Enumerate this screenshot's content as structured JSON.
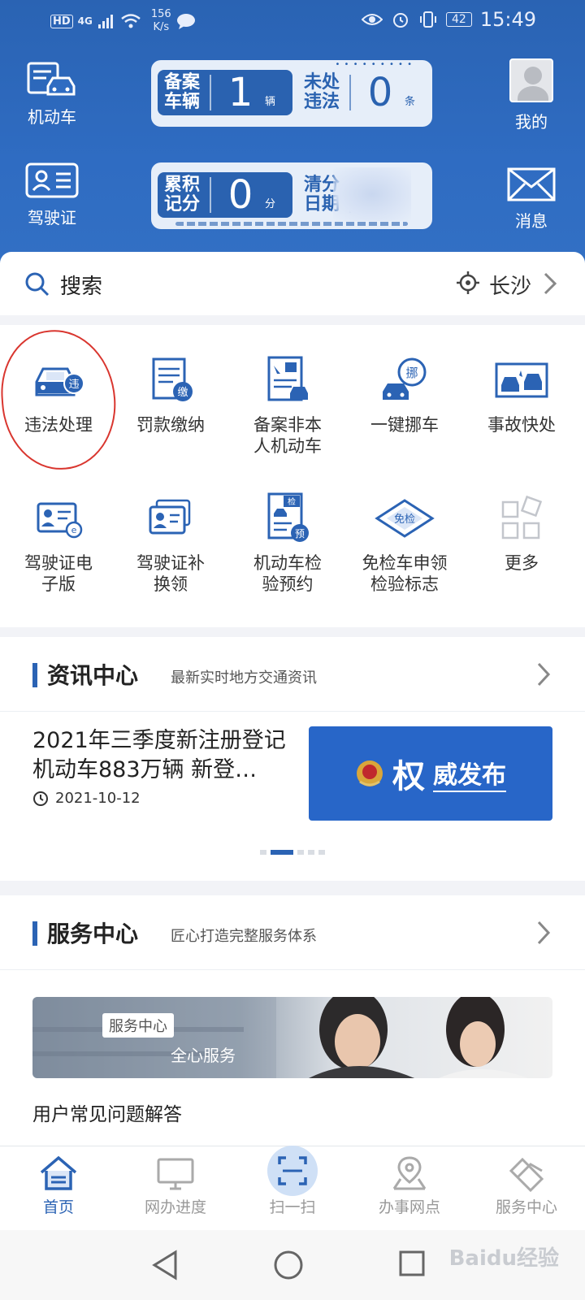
{
  "status_bar": {
    "hd": "HD",
    "network": "4G",
    "speed_value": "156",
    "speed_unit": "K/s",
    "battery": "42",
    "time": "15:49"
  },
  "header": {
    "left_top_label": "机动车",
    "left_bottom_label": "驾驶证",
    "right_top_label": "我的",
    "right_bottom_label": "消息",
    "panel1": {
      "left_label_line1": "备案",
      "left_label_line2": "车辆",
      "left_value": "1",
      "left_unit": "辆",
      "right_label_line1": "未处",
      "right_label_line2": "违法",
      "right_value": "0",
      "right_unit": "条"
    },
    "panel2": {
      "left_label_line1": "累积",
      "left_label_line2": "记分",
      "left_value": "0",
      "left_unit": "分",
      "right_label_line1": "清分",
      "right_label_line2": "日期"
    }
  },
  "search": {
    "placeholder": "搜索",
    "city": "长沙"
  },
  "services": [
    {
      "label": "违法处理",
      "icon": "car-violation-icon"
    },
    {
      "label": "罚款缴纳",
      "icon": "fine-payment-icon"
    },
    {
      "label": "备案非本人机动车",
      "icon": "register-vehicle-icon"
    },
    {
      "label": "一键挪车",
      "icon": "move-car-icon"
    },
    {
      "label": "事故快处",
      "icon": "accident-icon"
    },
    {
      "label": "驾驶证电子版",
      "icon": "e-license-icon"
    },
    {
      "label": "驾驶证补换领",
      "icon": "license-replace-icon"
    },
    {
      "label": "机动车检验预约",
      "icon": "inspection-booking-icon"
    },
    {
      "label": "免检车申领检验标志",
      "icon": "exempt-badge-icon"
    },
    {
      "label": "更多",
      "icon": "more-grid-icon"
    }
  ],
  "news_section": {
    "title": "资讯中心",
    "subtitle": "最新实时地方交通资讯",
    "item_title": "2021年三季度新注册登记机动车883万辆 新登…",
    "item_date": "2021-10-12",
    "image_text_big": "权",
    "image_text_rest": "威发布"
  },
  "service_section": {
    "title": "服务中心",
    "subtitle": "匠心打造完整服务体系",
    "banner_tag": "服务中心",
    "banner_text": "全心服务",
    "faq": "用户常见问题解答"
  },
  "tabbar": [
    {
      "label": "首页",
      "active": true
    },
    {
      "label": "网办进度",
      "active": false
    },
    {
      "label": "扫一扫",
      "active": false
    },
    {
      "label": "办事网点",
      "active": false
    },
    {
      "label": "服务中心",
      "active": false
    }
  ],
  "watermark": "Baidu经验",
  "colors": {
    "primary": "#2b63b4",
    "header_bg": "#2f6cc2",
    "annotation_red": "#d9362f"
  }
}
